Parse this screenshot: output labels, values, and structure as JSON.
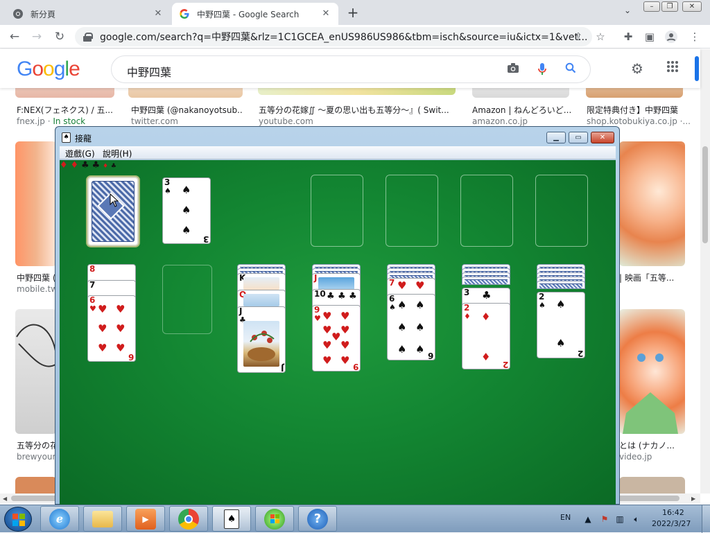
{
  "browser": {
    "tabs": [
      {
        "title": "新分頁",
        "favicon": "chrome-icon"
      },
      {
        "title": "中野四葉 - Google Search",
        "favicon": "google-icon"
      }
    ],
    "new_tab": "+",
    "url": "google.com/search?q=中野四葉&rlz=1C1GCEA_enUS986US986&tbm=isch&source=iu&ictx=1&vet..."
  },
  "google": {
    "logo": "Google",
    "query": "中野四葉",
    "results_row1": [
      {
        "title": "F:NEX(フェネクス) / 五...",
        "source": "fnex.jp",
        "extra": "In stock"
      },
      {
        "title": "中野四葉 (@nakanoyotsub...",
        "source": "twitter.com"
      },
      {
        "title": "五等分の花嫁∬ ～夏の思い出も五等分～』( Swit...",
        "source": "youtube.com"
      },
      {
        "title": "Amazon | ねんどろいど...",
        "source": "amazon.co.jp"
      },
      {
        "title": "限定特典付き】中野四葉",
        "source": "shop.kotobukiya.co.jp ·..."
      }
    ],
    "results_row2": [
      {
        "title": "中野四葉 (",
        "source": "mobile.twi"
      },
      {
        "title": "| 映画「五等...",
        "source": ""
      }
    ],
    "results_row3": [
      {
        "title": "五等分の花",
        "source": "brewyourc"
      },
      {
        "title": "とは (ナカノ...",
        "source": "video.jp"
      }
    ]
  },
  "solitaire": {
    "window_title": "接龍",
    "menus": [
      "遊戲(G)",
      "說明(H)"
    ],
    "waste": {
      "rank": "3",
      "suit": "♠",
      "color": "black"
    },
    "tableau": [
      {
        "hidden": 0,
        "cards": [
          {
            "rank": "8",
            "suit": "♦"
          },
          {
            "rank": "7",
            "suit": "♣"
          },
          {
            "rank": "6",
            "suit": "♥"
          }
        ]
      },
      {
        "hidden": 0,
        "cards": []
      },
      {
        "hidden": 2,
        "cards": [
          {
            "rank": "K",
            "suit": "♦"
          },
          {
            "rank": "Q",
            "suit": "♦"
          },
          {
            "rank": "J",
            "suit": "♣"
          }
        ]
      },
      {
        "hidden": 2,
        "cards": [
          {
            "rank": "J",
            "suit": "♦"
          },
          {
            "rank": "10",
            "suit": "♣"
          },
          {
            "rank": "9",
            "suit": "♥"
          }
        ]
      },
      {
        "hidden": 3,
        "cards": [
          {
            "rank": "7",
            "suit": "♥"
          },
          {
            "rank": "6",
            "suit": "♠"
          }
        ]
      },
      {
        "hidden": 4,
        "cards": [
          {
            "rank": "3",
            "suit": "♣"
          },
          {
            "rank": "2",
            "suit": "♦"
          }
        ]
      },
      {
        "hidden": 5,
        "cards": [
          {
            "rank": "2",
            "suit": "♠"
          }
        ]
      }
    ]
  },
  "taskbar": {
    "language": "EN",
    "time": "16:42",
    "date": "2022/3/27"
  },
  "colors": {
    "felt": "#138632",
    "google_blue": "#4285f4",
    "google_red": "#ea4335",
    "google_yellow": "#fbbc05",
    "google_green": "#34a853"
  }
}
